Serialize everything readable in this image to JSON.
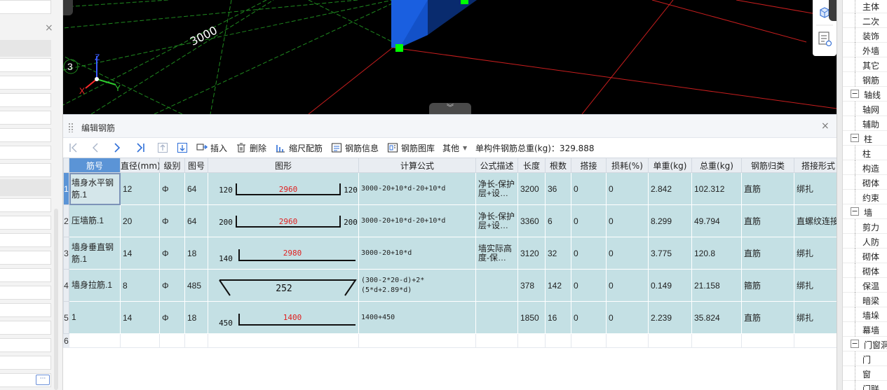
{
  "viewport": {
    "dimension_label": "3000",
    "axis_index": "3",
    "axis_labels": {
      "x": "X",
      "y": "Y",
      "z": "Z"
    },
    "collapse_glyph": "︾"
  },
  "left_panel": {
    "close_glyph": "×",
    "more_glyph": "···"
  },
  "editor": {
    "title": "编辑钢筋",
    "close_glyph": "×",
    "toolbar": {
      "insert": "插入",
      "delete": "删除",
      "scale_rebar": "缩尺配筋",
      "rebar_info": "钢筋信息",
      "rebar_library": "钢筋图库",
      "other": "其他",
      "total_weight": "单构件钢筋总重(kg)：329.888"
    },
    "columns": [
      "筋号",
      "直径(mm)",
      "级别",
      "图号",
      "图形",
      "计算公式",
      "公式描述",
      "长度",
      "根数",
      "搭接",
      "损耗(%)",
      "单重(kg)",
      "总重(kg)",
      "钢筋归类",
      "搭接形式"
    ],
    "rows": [
      {
        "num": "1",
        "name": "墙身水平钢筋.1",
        "diameter": "12",
        "grade": "Φ",
        "fig_no": "64",
        "shape": {
          "left": "120",
          "mid": "2960",
          "right": "120"
        },
        "formula": "3000-20+10*d-20+10*d",
        "desc": "净长-保护层+设…",
        "length": "3200",
        "count": "36",
        "lap": "0",
        "loss": "0",
        "unit_wt": "2.842",
        "total_wt": "102.312",
        "category": "直筋",
        "lap_type": "绑扎"
      },
      {
        "num": "2",
        "name": "压墙筋.1",
        "diameter": "20",
        "grade": "Φ",
        "fig_no": "64",
        "shape": {
          "left": "200",
          "mid": "2960",
          "right": "200"
        },
        "formula": "3000-20+10*d-20+10*d",
        "desc": "净长-保护层+设…",
        "length": "3360",
        "count": "6",
        "lap": "0",
        "loss": "0",
        "unit_wt": "8.299",
        "total_wt": "49.794",
        "category": "直筋",
        "lap_type": "直螺纹连接"
      },
      {
        "num": "3",
        "name": "墙身垂直钢筋.1",
        "diameter": "14",
        "grade": "Φ",
        "fig_no": "18",
        "shape": {
          "left": "140",
          "mid": "2980"
        },
        "formula": "3000-20+10*d",
        "desc": "墙实际高度-保…",
        "length": "3120",
        "count": "32",
        "lap": "0",
        "loss": "0",
        "unit_wt": "3.775",
        "total_wt": "120.8",
        "category": "直筋",
        "lap_type": "绑扎"
      },
      {
        "num": "4",
        "name": "墙身拉筋.1",
        "diameter": "8",
        "grade": "Φ",
        "fig_no": "485",
        "shape": {
          "mid": "252"
        },
        "formula": "(300-2*20-d)+2*(5*d+2.89*d)",
        "desc": "",
        "length": "378",
        "count": "142",
        "lap": "0",
        "loss": "0",
        "unit_wt": "0.149",
        "total_wt": "21.158",
        "category": "箍筋",
        "lap_type": "绑扎"
      },
      {
        "num": "5",
        "name": "1",
        "diameter": "14",
        "grade": "Φ",
        "fig_no": "18",
        "shape": {
          "left": "450",
          "mid": "1400"
        },
        "formula": "1400+450",
        "desc": "",
        "length": "1850",
        "count": "16",
        "lap": "0",
        "loss": "0",
        "unit_wt": "2.239",
        "total_wt": "35.824",
        "category": "直筋",
        "lap_type": "绑扎"
      }
    ],
    "empty_row_num": "6"
  },
  "tree": {
    "items": [
      {
        "label": "主体",
        "level": 2
      },
      {
        "label": "二次",
        "level": 2
      },
      {
        "label": "装饰",
        "level": 2
      },
      {
        "label": "外墙",
        "level": 2
      },
      {
        "label": "其它",
        "level": 2
      },
      {
        "label": "钢筋",
        "level": 2
      },
      {
        "label": "轴线",
        "level": 1,
        "toggle": "−"
      },
      {
        "label": "轴网",
        "level": 2
      },
      {
        "label": "辅助",
        "level": 2
      },
      {
        "label": "柱",
        "level": 1,
        "toggle": "−"
      },
      {
        "label": "柱",
        "level": 2
      },
      {
        "label": "构造",
        "level": 2
      },
      {
        "label": "砌体",
        "level": 2
      },
      {
        "label": "约束",
        "level": 2
      },
      {
        "label": "墙",
        "level": 1,
        "toggle": "−"
      },
      {
        "label": "剪力",
        "level": 2
      },
      {
        "label": "人防",
        "level": 2
      },
      {
        "label": "砌体",
        "level": 2
      },
      {
        "label": "砌体",
        "level": 2
      },
      {
        "label": "保温",
        "level": 2
      },
      {
        "label": "暗梁",
        "level": 2
      },
      {
        "label": "墙垛",
        "level": 2
      },
      {
        "label": "幕墙",
        "level": 2
      },
      {
        "label": "门窗洞",
        "level": 1,
        "toggle": "−"
      },
      {
        "label": "门",
        "level": 2
      },
      {
        "label": "窗",
        "level": 2
      },
      {
        "label": "门联",
        "level": 2
      }
    ]
  },
  "colors": {
    "grid_green": "#1f8a1f",
    "grid_red": "#c81e1e",
    "column_blue": "#1a5fe0",
    "marker_green": "#00ff00",
    "row_fill": "#c4e0e4",
    "header_selected": "#5b94d6",
    "shape_text_red": "#e02020"
  }
}
